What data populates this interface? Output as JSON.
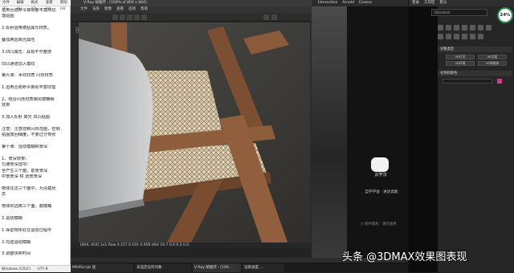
{
  "notes": {
    "menu": [
      "文件(F)",
      "编辑(E)",
      "格式(O)",
      "查看(V)",
      "帮助(H)"
    ],
    "lines": [
      "运用合成命令做出要丰富的纹",
      "理贴图",
      "",
      "2.反射运用镜贴属光材质。",
      "",
      "叠加两层高光属性",
      "",
      "3.凹凸属性：具有不平整感",
      "",
      "凹凸通道加入模纹",
      "",
      "第九课：木纹材质 闪烁材质",
      "",
      "1.运用合成命令做出丰富纹理",
      "",
      "2、结合闪烁材质做出镜瓣细",
      "效果",
      "",
      "3.加入反射 高光 凹凸贴图",
      "",
      "注意：注意控制闪烁范围，控制",
      "贴图放回细度，不要过分夸张",
      "",
      "第十课：运动模糊和景深",
      "",
      "1、景深效果：",
      "   匀速景深选项：",
      "   全产生三个面，前景景深",
      "中景景深 和 远景景深",
      "",
      "  物体在这三个面中，为清楚状",
      "态",
      "",
      "  物体的远离三个面，越模糊",
      "",
      "2.运动模糊",
      "",
      "1.保证物体处在运动过程中",
      "",
      "2.勾选运动模糊",
      "",
      "3.调整快照时间"
    ],
    "status_left": "Windows (CRLF)",
    "status_right": "UTF-8"
  },
  "vfb": {
    "title": "V-Ray 帧缓存 - [100% of 800 x 844]",
    "menu": [
      "文件",
      "渲染",
      "图像",
      "查看",
      "选项",
      "帮助"
    ],
    "channel": "RGB color",
    "status": "[604, 654]    1x1  Raw   0.157  0.101  0.059  HSV  19.7  0.6  0.2  0.0",
    "colors": {
      "wood": "#8a5a3a",
      "wood_dark": "#5e3b24",
      "cane": "#d9cbb0",
      "concrete": "#6a6863",
      "table": "#b9bbbd"
    }
  },
  "viewport": {
    "strip": [
      "Interactive",
      "Arnold",
      "Corona"
    ],
    "logo_text": "云学汉",
    "logo_sub": "自学学会 · 进达高能",
    "watermark": "Ⓢ 图书版权 · 请勿盗用"
  },
  "cmd": {
    "top": [
      "登录",
      "工作区",
      "默认"
    ],
    "search": "Standard",
    "badge": "24%",
    "roll1": "对象类型",
    "roll2": "名称和颜色",
    "buttons": [
      "VR灯光",
      "VR太阳",
      "VR环境",
      "VR网格体"
    ]
  },
  "taskbar": {
    "tasks": [
      "MAXScript 迷",
      "未选定任何对象",
      "V-Ray 帧缓存 - [100...",
      "渲染进度 ..."
    ],
    "caption": "头条 @3DMAX效果图表现"
  }
}
